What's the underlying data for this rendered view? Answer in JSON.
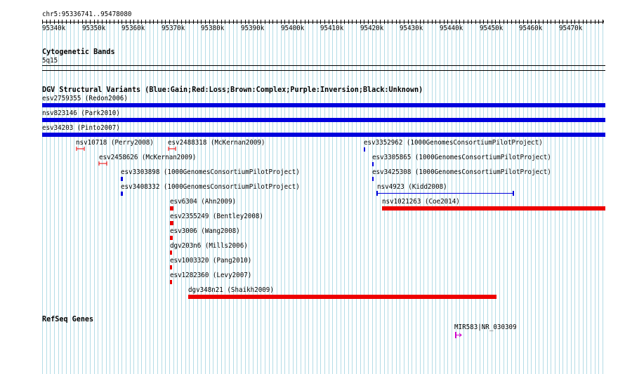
{
  "colors": {
    "gain": "#0000dd",
    "loss": "#ee0000",
    "grid": "#b4dce6",
    "refseq": "#cc00cc",
    "text": "#000000"
  },
  "ruler": {
    "range_label": "chr5:95336741..95478080",
    "tick_labels": [
      "95340k",
      "95350k",
      "95360k",
      "95370k",
      "95380k",
      "95390k",
      "95400k",
      "95410k",
      "95420k",
      "95430k",
      "95440k",
      "95450k",
      "95460k",
      "95470k"
    ]
  },
  "tracks": {
    "cytoband": {
      "title": "Cytogenetic Bands",
      "band_label": "5q15"
    },
    "dgv": {
      "title": "DGV Structural Variants (Blue:Gain;Red:Loss;Brown:Complex;Purple:Inversion;Black:Unknown)",
      "variants": [
        {
          "label": "esv2759355 (Redon2006)",
          "type": "gain"
        },
        {
          "label": "nsv823146 (Park2010)",
          "type": "gain"
        },
        {
          "label": "esv34203 (Pinto2007)",
          "type": "gain"
        },
        {
          "label": "nsv10718 (Perry2008)",
          "type": "loss"
        },
        {
          "label": "esv2488318 (McKernan2009)",
          "type": "loss"
        },
        {
          "label": "esv3352962 (1000GenomesConsortiumPilotProject)",
          "type": "gain"
        },
        {
          "label": "esv2458626 (McKernan2009)",
          "type": "loss"
        },
        {
          "label": "esv3305865 (1000GenomesConsortiumPilotProject)",
          "type": "gain"
        },
        {
          "label": "esv3303898 (1000GenomesConsortiumPilotProject)",
          "type": "gain"
        },
        {
          "label": "esv3425308 (1000GenomesConsortiumPilotProject)",
          "type": "gain"
        },
        {
          "label": "esv3408332 (1000GenomesConsortiumPilotProject)",
          "type": "gain"
        },
        {
          "label": "nsv4923 (Kidd2008)",
          "type": "gain"
        },
        {
          "label": "esv6304 (Ahn2009)",
          "type": "loss"
        },
        {
          "label": "nsv1021263 (Coe2014)",
          "type": "loss"
        },
        {
          "label": "esv2355249 (Bentley2008)",
          "type": "loss"
        },
        {
          "label": "esv3006 (Wang2008)",
          "type": "loss"
        },
        {
          "label": "dgv203n6 (Mills2006)",
          "type": "loss"
        },
        {
          "label": "esv1003320 (Pang2010)",
          "type": "loss"
        },
        {
          "label": "esv1282360 (Levy2007)",
          "type": "loss"
        },
        {
          "label": "dgv348n21 (Shaikh2009)",
          "type": "loss"
        }
      ]
    },
    "refseq": {
      "title": "RefSeq Genes",
      "genes": [
        {
          "label": "MIR583|NR_030309"
        }
      ]
    }
  }
}
